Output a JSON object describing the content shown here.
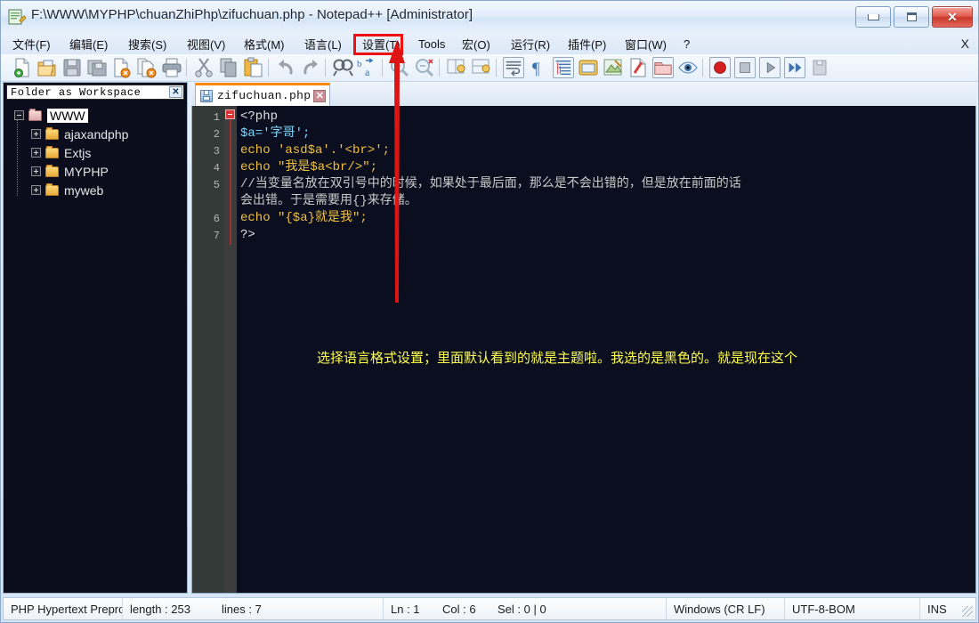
{
  "window": {
    "title": "F:\\WWW\\MYPHP\\chuanZhiPhp\\zifuchuan.php - Notepad++ [Administrator]",
    "icon": "notepad-plus-plus-icon",
    "minimize_label": "–",
    "maximize_label": "□",
    "close_label": "✕"
  },
  "menubar": {
    "items": [
      {
        "label": "文件(F)",
        "mnemonic": "F"
      },
      {
        "label": "编辑(E)",
        "mnemonic": "E"
      },
      {
        "label": "搜索(S)",
        "mnemonic": "S"
      },
      {
        "label": "视图(V)",
        "mnemonic": "V"
      },
      {
        "label": "格式(M)",
        "mnemonic": "M"
      },
      {
        "label": "语言(L)",
        "mnemonic": "L"
      },
      {
        "label": "设置(T)",
        "mnemonic": "T"
      },
      {
        "label": "Tools",
        "mnemonic": ""
      },
      {
        "label": "宏(O)",
        "mnemonic": "O"
      },
      {
        "label": "运行(R)",
        "mnemonic": "R"
      },
      {
        "label": "插件(P)",
        "mnemonic": "P"
      },
      {
        "label": "窗口(W)",
        "mnemonic": "W"
      },
      {
        "label": "?",
        "mnemonic": ""
      }
    ],
    "close_doc_label": "X"
  },
  "toolbar": {
    "buttons": [
      "new-file-icon",
      "open-file-icon",
      "save-icon",
      "save-all-icon",
      "close-file-icon",
      "close-all-icon",
      "print-icon",
      "cut-icon",
      "copy-icon",
      "paste-icon",
      "undo-icon",
      "redo-icon",
      "find-icon",
      "replace-icon",
      "zoom-in-icon",
      "zoom-out-icon",
      "sync-vertical-icon",
      "sync-horizontal-icon",
      "word-wrap-icon",
      "show-all-chars-icon",
      "indent-guide-icon",
      "user-defined-dialog-icon",
      "show-doc-map-icon",
      "function-list-icon",
      "folder-as-workspace-icon",
      "monitoring-icon",
      "record-macro-icon",
      "stop-recording-icon",
      "playback-icon",
      "run-macro-multiple-icon",
      "save-macro-icon"
    ]
  },
  "workspace": {
    "panel_title": "Folder as Workspace",
    "close_label": "✕",
    "tree": [
      {
        "label": "WWW",
        "icon": "root-folder-icon",
        "expanded": true,
        "depth": 0,
        "selected": true
      },
      {
        "label": "ajaxandphp",
        "icon": "folder-icon",
        "expanded": false,
        "depth": 1,
        "selected": false
      },
      {
        "label": "Extjs",
        "icon": "folder-icon",
        "expanded": false,
        "depth": 1,
        "selected": false
      },
      {
        "label": "MYPHP",
        "icon": "folder-icon",
        "expanded": false,
        "depth": 1,
        "selected": false
      },
      {
        "label": "myweb",
        "icon": "folder-icon",
        "expanded": false,
        "depth": 1,
        "selected": false
      }
    ]
  },
  "tabs": [
    {
      "label": "zifuchuan.php",
      "icon": "saved-file-icon",
      "close_label": "✕",
      "active": true
    }
  ],
  "editor": {
    "line_numbers": [
      "1",
      "2",
      "3",
      "4",
      "5",
      "6",
      "7"
    ],
    "lines": [
      {
        "n": "1",
        "text": "<?php"
      },
      {
        "n": "2",
        "text": "$a='字哥';"
      },
      {
        "n": "3",
        "text": "echo 'asd$a'.'<br>';"
      },
      {
        "n": "4",
        "text": "echo \"我是$a<br/>\";"
      },
      {
        "n": "5",
        "text": "//当变量名放在双引号中的时候，如果处于最后面，那么是不会出错的，但是放在前面的话会出错。于是需要用{}来存储。"
      },
      {
        "n": "6",
        "text": "echo \"{$a}就是我\";"
      },
      {
        "n": "7",
        "text": "?>"
      }
    ],
    "wrapped_segments": {
      "line5_part1": "//当变量名放在双引号中的时候，如果处于最后面，那么是不会出错的，但是放在前面的话",
      "line5_part2": "会出错。于是需要用{}来存储。"
    },
    "annotation_note": "选择语言格式设置；里面默认看到的就是主题啦。我选的是黑色的。就是现在这个"
  },
  "annotation": {
    "target_menu": "设置(T)",
    "box_color": "#ee1111",
    "arrow_color": "#dd1414"
  },
  "statusbar": {
    "language": "PHP Hypertext Preproc",
    "length": "length : 253",
    "lines": "lines : 7",
    "ln": "Ln : 1",
    "col": "Col : 6",
    "sel": "Sel : 0 | 0",
    "eol": "Windows (CR LF)",
    "encoding": "UTF-8-BOM",
    "insert_mode": "INS"
  },
  "colors": {
    "editor_bg": "#0b0e1e",
    "gutter_bg": "#333a38",
    "fold_bg": "#3c3c3c",
    "keyword": "#f0c040",
    "string": "#6ecb63",
    "comment": "#c9c9c9",
    "note": "#ffff4d",
    "tab_active_top": "#ff8c00"
  }
}
